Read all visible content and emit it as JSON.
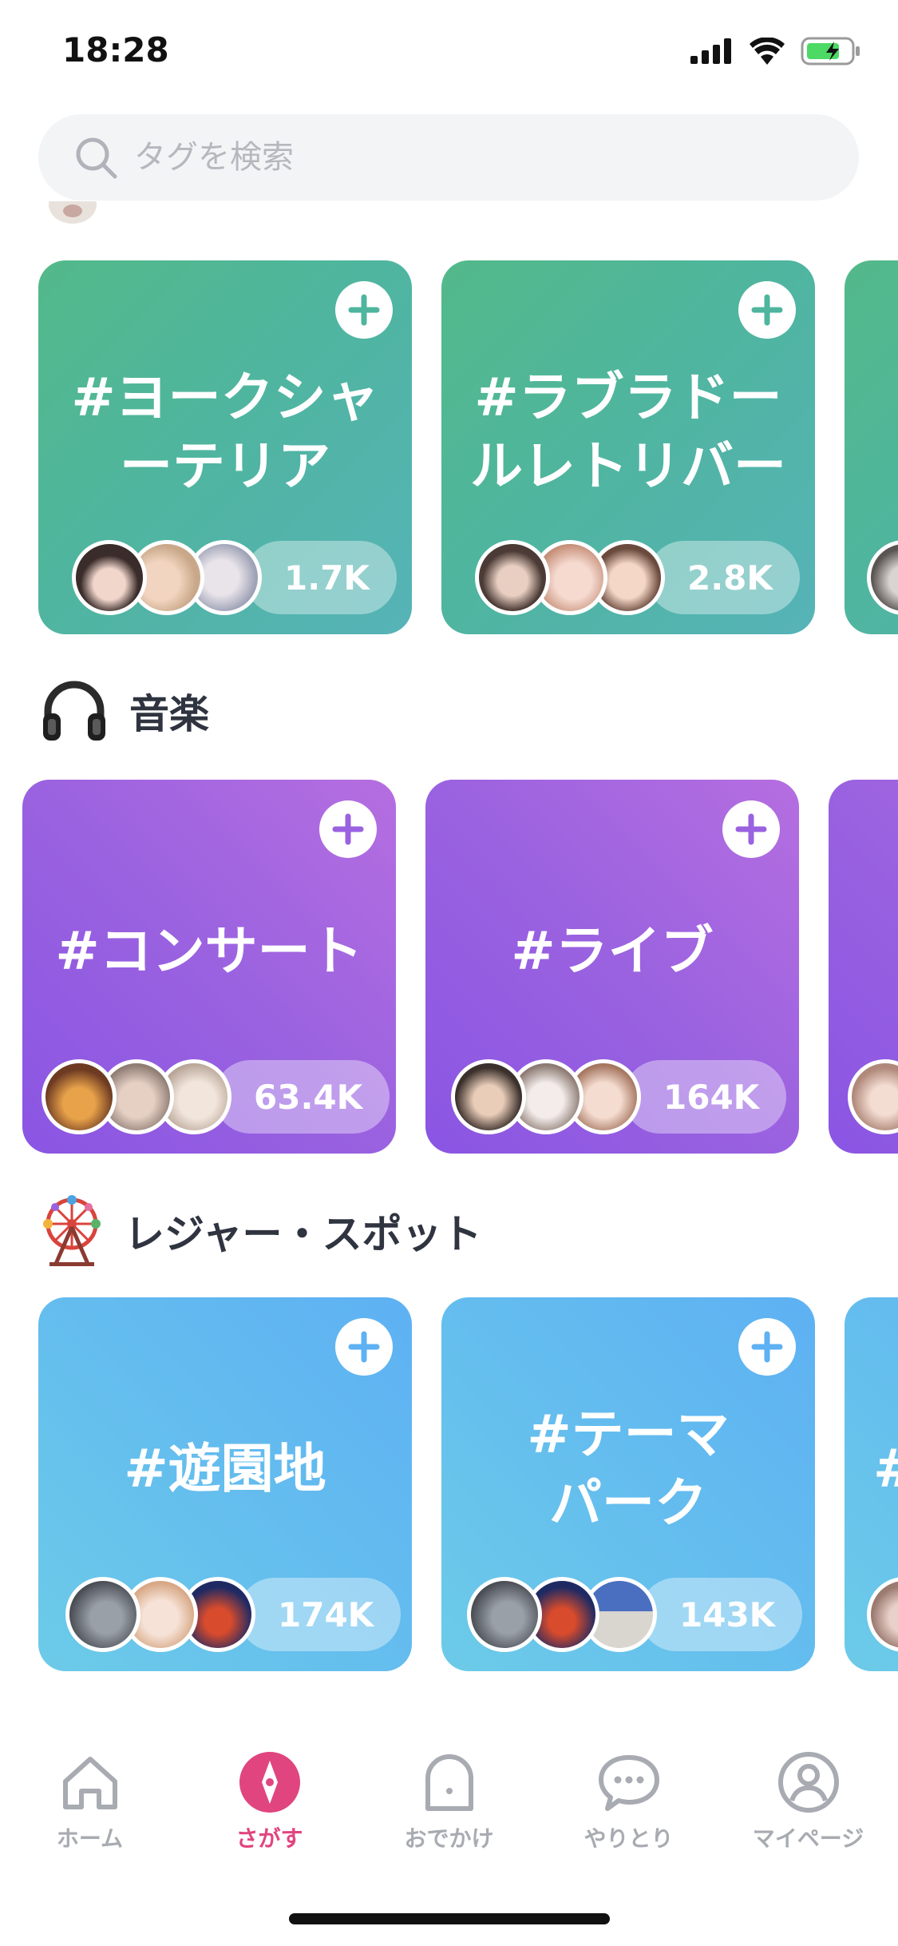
{
  "status": {
    "time": "18:28"
  },
  "search": {
    "placeholder": "タグを検索"
  },
  "sections": [
    {
      "title": "音楽",
      "icon": "headphones-icon",
      "cards": [
        {
          "tag": "#コンサート",
          "count": "63.4K"
        },
        {
          "tag": "#ライブ",
          "count": "164K"
        }
      ]
    },
    {
      "title": "レジャー・スポット",
      "icon": "ferris-wheel-icon",
      "cards": [
        {
          "tag": "#遊園地",
          "count": "174K"
        },
        {
          "tag": "#テーマ\nパーク",
          "count": "143K"
        }
      ]
    }
  ],
  "top_cards": [
    {
      "tag": "#ヨークシャ\nーテリア",
      "count": "1.7K"
    },
    {
      "tag": "#ラブラドー\nルレトリバー",
      "count": "2.8K"
    }
  ],
  "tabs": [
    {
      "label": "ホーム",
      "icon": "home-icon",
      "active": false
    },
    {
      "label": "さがす",
      "icon": "compass-icon",
      "active": true
    },
    {
      "label": "おでかけ",
      "icon": "ghost-icon",
      "active": false
    },
    {
      "label": "やりとり",
      "icon": "chat-bubble-icon",
      "active": false
    },
    {
      "label": "マイページ",
      "icon": "profile-icon",
      "active": false
    }
  ],
  "colors": {
    "accent": "#e0457f",
    "green_card": "#53b98a",
    "purple_card": "#9a62e0",
    "blue_card": "#5eb1f3"
  }
}
